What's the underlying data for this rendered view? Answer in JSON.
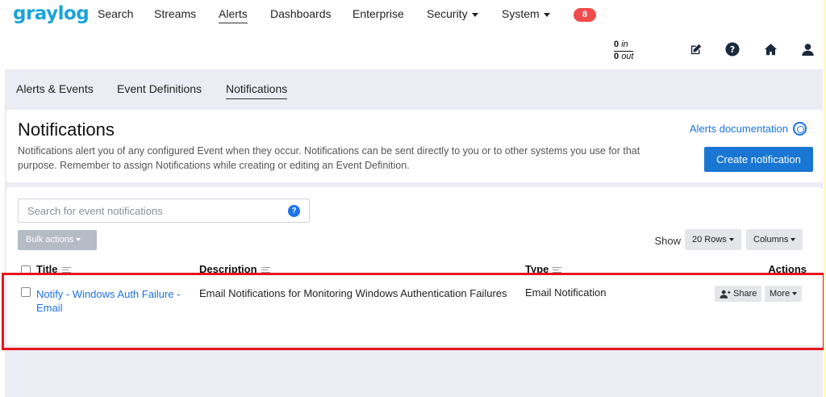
{
  "app": {
    "logo": "graylog"
  },
  "nav": {
    "items": [
      {
        "label": "Search",
        "has_menu": false,
        "active": false
      },
      {
        "label": "Streams",
        "has_menu": false,
        "active": false
      },
      {
        "label": "Alerts",
        "has_menu": false,
        "active": true
      },
      {
        "label": "Dashboards",
        "has_menu": false,
        "active": false
      },
      {
        "label": "Enterprise",
        "has_menu": false,
        "active": false
      },
      {
        "label": "Security",
        "has_menu": true,
        "active": false
      },
      {
        "label": "System",
        "has_menu": true,
        "active": false
      }
    ],
    "notification_count": "8"
  },
  "throughput": {
    "in_value": "0",
    "in_label": "in",
    "out_value": "0",
    "out_label": "out"
  },
  "header_icons": [
    "edit-icon",
    "help-icon",
    "home-icon",
    "user-icon"
  ],
  "subnav": {
    "items": [
      {
        "label": "Alerts & Events",
        "active": false
      },
      {
        "label": "Event Definitions",
        "active": false
      },
      {
        "label": "Notifications",
        "active": true
      }
    ]
  },
  "page": {
    "title": "Notifications",
    "description": "Notifications alert you of any configured Event when they occur. Notifications can be sent directly to you or to other systems you use for that purpose. Remember to assign Notifications while creating or editing an Event Definition.",
    "docs_link": "Alerts documentation",
    "create_button": "Create notification"
  },
  "list": {
    "search_placeholder": "Search for event notifications",
    "bulk_actions": "Bulk actions",
    "show_label": "Show",
    "rows_select": "20 Rows",
    "columns_button": "Columns",
    "columns": [
      "Title",
      "Description",
      "Type",
      "Actions"
    ],
    "rows": [
      {
        "title": "Notify - Windows Auth Failure - Email",
        "description": "Email Notifications for Monitoring Windows Authentication Failures",
        "type": "Email Notification",
        "share_label": "Share",
        "more_label": "More"
      }
    ]
  },
  "colors": {
    "brand": "#1aa3d9",
    "primary": "#1976d2",
    "link": "#1a73e8",
    "badge": "#f24b4b",
    "highlight": "#e8141b"
  }
}
